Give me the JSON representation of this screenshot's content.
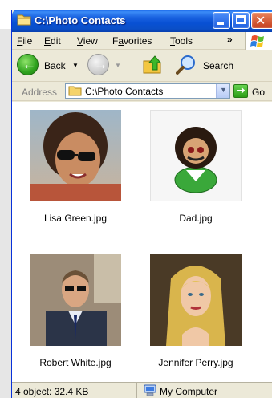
{
  "window": {
    "title": "C:\\Photo Contacts"
  },
  "menu": {
    "items": [
      "File",
      "Edit",
      "View",
      "Favorites",
      "Tools"
    ],
    "underline": [
      "F",
      "E",
      "V",
      "a",
      "T"
    ],
    "overflow": "»"
  },
  "toolbar": {
    "back": "Back",
    "search": "Search"
  },
  "address": {
    "label": "Address",
    "value": "C:\\Photo Contacts",
    "go": "Go"
  },
  "files": [
    {
      "name": "Lisa Green.jpg"
    },
    {
      "name": "Dad.jpg"
    },
    {
      "name": "Robert White.jpg"
    },
    {
      "name": "Jennifer Perry.jpg"
    }
  ],
  "status": {
    "objects": "4 object: 32.4 KB",
    "zone": "My Computer"
  },
  "colors": {
    "titlebar": "#0a4fc8",
    "chrome": "#ece9d8",
    "go": "#2c9d16"
  },
  "icons": [
    "folder-icon",
    "minimize-icon",
    "maximize-icon",
    "close-icon",
    "windows-logo-icon",
    "back-arrow-icon",
    "forward-arrow-icon",
    "folder-up-icon",
    "search-icon",
    "dropdown-arrow-icon",
    "go-arrow-icon",
    "my-computer-icon"
  ]
}
